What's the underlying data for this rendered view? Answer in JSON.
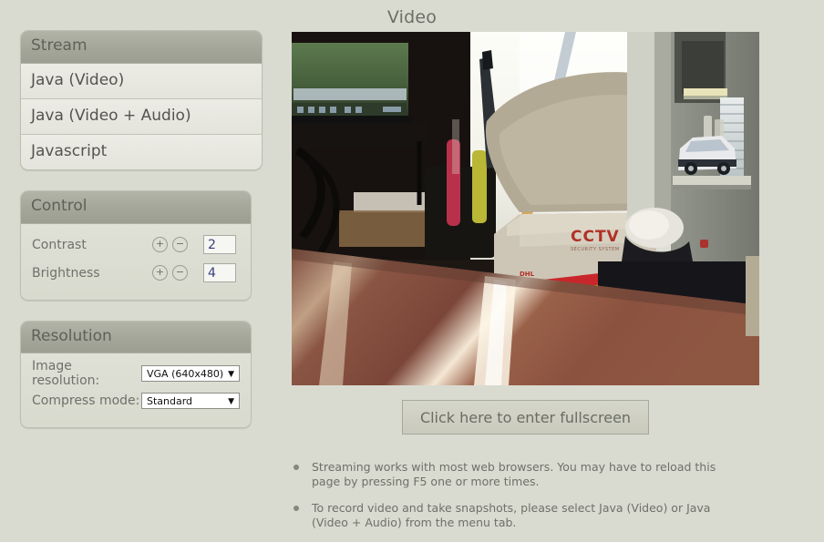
{
  "page": {
    "title": "Video",
    "background_color": "#d9dbd0"
  },
  "sidebar": {
    "stream_panel": {
      "header": "Stream",
      "items": [
        {
          "label": "Java (Video)"
        },
        {
          "label": "Java (Video + Audio)"
        },
        {
          "label": "Javascript"
        }
      ]
    },
    "control_panel": {
      "header": "Control",
      "rows": [
        {
          "label": "Contrast",
          "plus": "+",
          "minus": "−",
          "value": "2"
        },
        {
          "label": "Brightness",
          "plus": "+",
          "minus": "−",
          "value": "4"
        }
      ]
    },
    "resolution_panel": {
      "header": "Resolution",
      "rows": [
        {
          "label": "Image resolution:",
          "value": "VGA (640x480)",
          "arrow": "▼"
        },
        {
          "label": "Compress mode:",
          "value": "Standard",
          "arrow": "▼"
        }
      ]
    }
  },
  "video": {
    "alt": "live-camera-stream",
    "fullscreen_button": "Click here to enter fullscreen"
  },
  "notes": [
    {
      "text": "Streaming works with most web browsers. You may have to reload this page by pressing F5 one or more times."
    },
    {
      "text": "To record video and take snapshots, please select Java (Video) or Java (Video + Audio) from the menu tab."
    }
  ],
  "colors": {
    "panel_header": "#a5a69a",
    "panel_body": "#dcded3",
    "list_item": "#e8e8e0",
    "text_muted": "#6f7069",
    "input_text": "#3b3f7a"
  }
}
